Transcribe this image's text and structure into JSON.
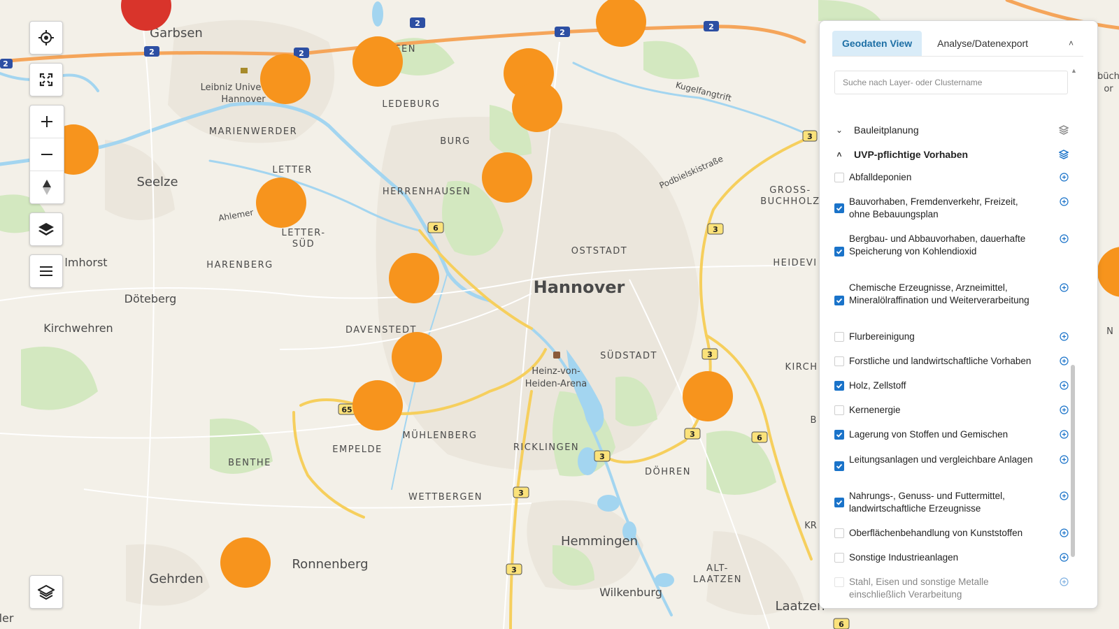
{
  "map": {
    "labels": {
      "garbsen": "Garbsen",
      "seelze": "Seelze",
      "hannover": "Hannover",
      "leibniz_uni": "Leibniz Unive",
      "hannover_small": "Hannover",
      "marienwerder": "MARIENWERDER",
      "ledeburg": "LEDEBURG",
      "burg": "BURG",
      "letter": "LETTER",
      "herrenhausen": "HERRENHAUSEN",
      "letter_sued_1": "LETTER-",
      "letter_sued_2": "SÜD",
      "harenberg": "HARENBERG",
      "almhorst": "lmhorst",
      "doeteberg": "Döteberg",
      "kirchwehren": "Kirchwehren",
      "davenstedt": "DAVENSTEDT",
      "oststadt": "OSTSTADT",
      "suedstadt": "SÜDSTADT",
      "heinz_1": "Heinz-von-",
      "heinz_2": "Heiden-Arena",
      "muehlenberg": "MÜHLENBERG",
      "empelde": "EMPELDE",
      "benthe": "BENTHE",
      "ricklingen": "RICKLINGEN",
      "wettbergen": "WETTBERGEN",
      "doehren": "DÖHREN",
      "hemmingen": "Hemmingen",
      "alt_laatzen_1": "ALT-",
      "alt_laatzen_2": "LAATZEN",
      "wilkenburg": "Wilkenburg",
      "laatzen": "Laatzen",
      "ronnenberg": "Ronnenberg",
      "gehrden": "Gehrden",
      "kugelfangtrift": "Kugelfangtrift",
      "podbielskistrasse": "Podbielskistraße",
      "ahlemer": "Ahlemer",
      "gross_buchholz_1": "GROSS-",
      "gross_buchholz_2": "BUCHHOLZ",
      "heideviertel": "HEIDEVI",
      "kirchrode": "KIRCH",
      "edge_n": "N",
      "edge_b": "B",
      "edge_kr": "KR",
      "edge_ler": "ler",
      "edge_buech_1": "büch",
      "edge_buech_2": "or",
      "partial_fen": "FEN"
    },
    "road_shields": {
      "a2_1": "2",
      "a2_2": "2",
      "a2_3": "2",
      "a2_4": "2",
      "a2_5": "2",
      "a2_6": "2",
      "b6": "6",
      "b65": "65",
      "b3_1": "3",
      "b3_2": "3",
      "b3_3": "3",
      "b3_4": "3",
      "b3_5": "3",
      "b3_6": "3",
      "b3_7": "3",
      "b6_2": "6",
      "b6_3": "6"
    },
    "cluster_color": "#f7941d",
    "cluster_red": "#d9342b",
    "water_color": "#a3d5f0",
    "green_color": "#d3e8c0"
  },
  "controls": {
    "locate": "locate-icon",
    "fullscreen": "fullscreen-icon",
    "zoom_in": "plus-icon",
    "zoom_out": "minus-icon",
    "north": "compass-icon",
    "layers": "layers-icon",
    "menu": "menu-icon",
    "basemap": "layers-icon"
  },
  "panel": {
    "tabs": [
      {
        "label": "Geodaten View"
      },
      {
        "label": "Analyse/Datenexport"
      }
    ],
    "collapse": "˄",
    "search_placeholder": "Suche nach Layer- oder Clustername",
    "groups": [
      {
        "label": "Bauleitplanung",
        "expanded": false
      },
      {
        "label": "UVP-pflichtige Vorhaben",
        "expanded": true
      }
    ],
    "items": [
      {
        "label": "Abfalldeponien",
        "checked": false
      },
      {
        "label": "Bauvorhaben, Fremdenverkehr, Freizeit, ohne Bebauungsplan",
        "checked": true
      },
      {
        "label": "Bergbau- und Abbauvorhaben, dauerhafte Speicherung von Kohlendioxid",
        "checked": true
      },
      {
        "label": "Chemische Erzeugnisse, Arzneimittel, Mineralölraffination und Weiterverarbeitung",
        "checked": true
      },
      {
        "label": "Flurbereinigung",
        "checked": false
      },
      {
        "label": "Forstliche und landwirtschaftliche Vorhaben",
        "checked": false
      },
      {
        "label": "Holz, Zellstoff",
        "checked": true
      },
      {
        "label": "Kernenergie",
        "checked": false
      },
      {
        "label": "Lagerung von Stoffen und Gemischen",
        "checked": true
      },
      {
        "label": "Leitungsanlagen und vergleichbare Anlagen",
        "checked": true
      },
      {
        "label": "Nahrungs-, Genuss- und Futtermittel, landwirtschaftliche Erzeugnisse",
        "checked": true
      },
      {
        "label": "Oberflächenbehandlung von Kunststoffen",
        "checked": false
      },
      {
        "label": "Sonstige Industrieanlagen",
        "checked": false
      },
      {
        "label": "Stahl, Eisen und sonstige Metalle einschließlich Verarbeitung",
        "checked": false
      }
    ]
  }
}
